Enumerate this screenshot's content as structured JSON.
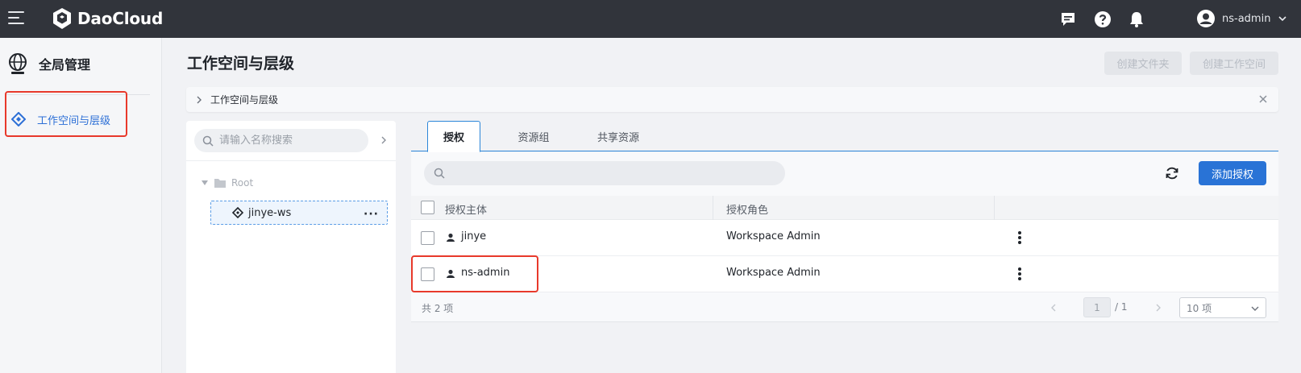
{
  "header": {
    "brand": "DaoCloud",
    "username": "ns-admin"
  },
  "sidebar": {
    "title": "全局管理",
    "items": [
      {
        "label": "工作空间与层级",
        "active": true
      }
    ]
  },
  "page": {
    "title": "工作空间与层级",
    "create_folder_label": "创建文件夹",
    "create_workspace_label": "创建工作空间"
  },
  "breadcrumb": {
    "current": "工作空间与层级"
  },
  "tree": {
    "search_placeholder": "请输入名称搜索",
    "root_label": "Root",
    "selected_node": "jinye-ws"
  },
  "tabs": [
    {
      "label": "授权",
      "active": true
    },
    {
      "label": "资源组",
      "active": false
    },
    {
      "label": "共享资源",
      "active": false
    }
  ],
  "toolbar": {
    "search_value": "",
    "add_label": "添加授权"
  },
  "table": {
    "columns": [
      "授权主体",
      "授权角色"
    ],
    "rows": [
      {
        "subject": "jinye",
        "role": "Workspace Admin"
      },
      {
        "subject": "ns-admin",
        "role": "Workspace Admin"
      }
    ]
  },
  "pagination": {
    "total_text": "共 2 项",
    "current_page": "1",
    "total_pages": "/ 1",
    "page_size": "10 项"
  },
  "colors": {
    "topbar": "#31343b",
    "accent": "#2973d6",
    "highlight": "#e8392b"
  }
}
